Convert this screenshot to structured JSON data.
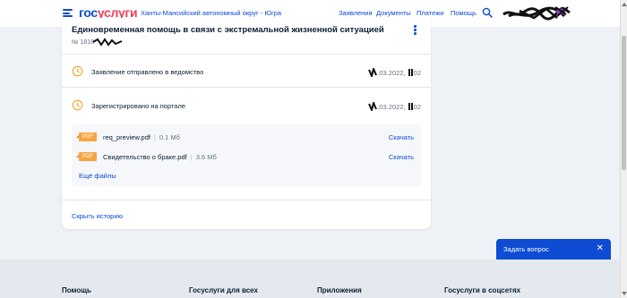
{
  "header": {
    "logo_part1": "гос",
    "logo_part2": "услуги",
    "region": "Ханты-Мансийский автономный округ - Югра",
    "nav": [
      "Заявления",
      "Документы",
      "Платежи",
      "Помощь"
    ]
  },
  "card": {
    "title": "Единовременная помощь в связи с экстремальной жизненной ситуацией",
    "app_number_prefix": "№ 1818",
    "statuses": [
      {
        "text": "Заявление отправлено в ведомство",
        "date_visible": ".03.2022,",
        "time_visible": "02"
      },
      {
        "text": "Зарегистрировано на портале",
        "date_visible": ".03.2022,",
        "time_visible": "02"
      }
    ],
    "files": [
      {
        "type": "PDF",
        "name": "req_preview.pdf",
        "size": "0.1 Мб",
        "action": "Скачать"
      },
      {
        "type": "PDF",
        "name": "Свидетельство о браке.pdf",
        "size": "3.6 Мб",
        "action": "Скачать"
      }
    ],
    "more_files": "Ещё файлы",
    "hide_history": "Скрыть историю"
  },
  "ask_widget": {
    "label": "Задать вопрос",
    "close": "✕"
  },
  "footer": {
    "columns": [
      "Помощь",
      "Госуслуги для всех",
      "Приложения",
      "Госуслуги в соцсетях"
    ]
  },
  "colors": {
    "brand_blue": "#0d4cd3",
    "brand_red": "#ee3f58",
    "pdf_orange": "#f6a544",
    "clock_yellow": "#f5a623"
  }
}
